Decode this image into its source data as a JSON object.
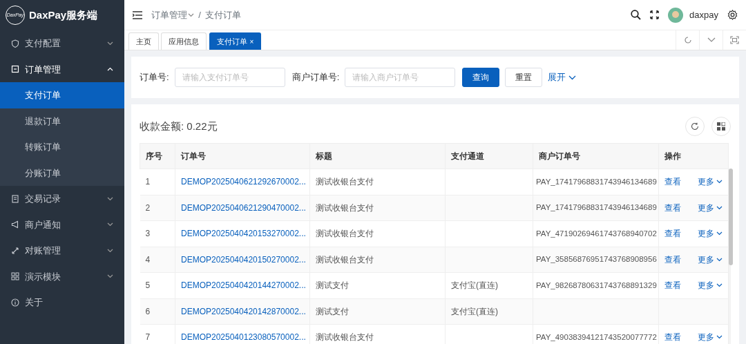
{
  "brand": {
    "logo_text": "DaxPay",
    "name": "DaxPay服务端"
  },
  "sidebar": {
    "items": [
      {
        "label": "支付配置",
        "expanded": false
      },
      {
        "label": "订单管理",
        "expanded": true,
        "children": [
          {
            "label": "支付订单",
            "selected": true
          },
          {
            "label": "退款订单",
            "selected": false
          },
          {
            "label": "转账订单",
            "selected": false
          },
          {
            "label": "分账订单",
            "selected": false
          }
        ]
      },
      {
        "label": "交易记录",
        "expanded": false
      },
      {
        "label": "商户通知",
        "expanded": false
      },
      {
        "label": "对账管理",
        "expanded": false
      },
      {
        "label": "演示模块",
        "expanded": false
      },
      {
        "label": "关于"
      }
    ]
  },
  "header": {
    "breadcrumb": [
      {
        "label": "订单管理",
        "dropdown": true
      },
      {
        "label": "支付订单"
      }
    ],
    "breadcrumb_separator": "/",
    "username": "daxpay"
  },
  "tabs": [
    {
      "label": "主页",
      "selected": false,
      "closable": false
    },
    {
      "label": "应用信息",
      "selected": false,
      "closable": false
    },
    {
      "label": "支付订单",
      "selected": true,
      "closable": true,
      "close_glyph": "×"
    }
  ],
  "search": {
    "fields": [
      {
        "label": "订单号:",
        "placeholder": "请输入支付订单号"
      },
      {
        "label": "商户订单号:",
        "placeholder": "请输入商户订单号"
      }
    ],
    "buttons": [
      {
        "label": "查询",
        "kind": "primary"
      },
      {
        "label": "重置",
        "kind": "default"
      }
    ],
    "expand_link": "展开"
  },
  "summary": "收款金额: 0.22元",
  "table": {
    "columns": [
      "序号",
      "订单号",
      "标题",
      "支付通道",
      "商户订单号",
      "操作"
    ],
    "rows": [
      {
        "index": "1",
        "order_no": "DEMOP2025040621292670002...",
        "title": "测试收银台支付",
        "merchant_no": "PAY_17417968831743946134689",
        "actions": [
          "查看",
          "更多"
        ]
      },
      {
        "index": "2",
        "order_no": "DEMOP2025040621290470002...",
        "title": "测试收银台支付",
        "merchant_no": "PAY_17417968831743946134689",
        "actions": [
          "查看",
          "更多"
        ]
      },
      {
        "index": "3",
        "order_no": "DEMOP2025040420153270002...",
        "title": "测试收银台支付",
        "merchant_no": "PAY_47190269461743768940702",
        "actions": [
          "查看",
          "更多"
        ]
      },
      {
        "index": "4",
        "order_no": "DEMOP2025040420150270002...",
        "title": "测试收银台支付",
        "merchant_no": "PAY_35856876951743768908956",
        "actions": [
          "查看",
          "更多"
        ]
      },
      {
        "index": "5",
        "order_no": "DEMOP2025040420144270002...",
        "title": "测试支付",
        "channel": "支付宝(直连)",
        "merchant_no": "PAY_98268780631743768891329",
        "actions": [
          "查看",
          "更多"
        ]
      },
      {
        "index": "6",
        "order_no": "DEMOP2025040420142870002...",
        "title": "测试支付",
        "channel": "支付宝(直连)"
      },
      {
        "index": "7",
        "order_no": "DEMOP2025040123080570002...",
        "title": "测试收银台支付",
        "merchant_no": "PAY_49038394121743520077772",
        "actions": [
          "查看",
          "更多"
        ]
      }
    ]
  }
}
